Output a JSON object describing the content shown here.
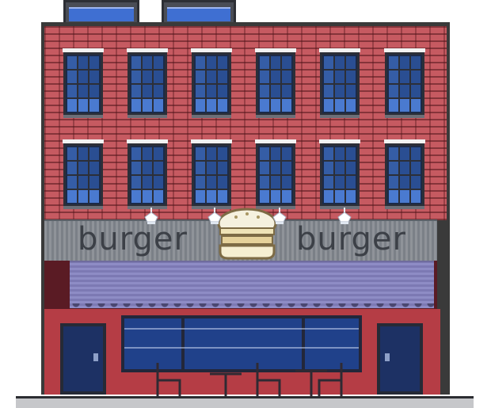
{
  "scene": {
    "description_label": "",
    "sign": {
      "left_word": "burger",
      "right_word": "burger",
      "logo": "burger-icon"
    },
    "colors": {
      "brick": "#c65a61",
      "awning": "#8e8cc5",
      "window_glass": "#2a4e92",
      "storefront": "#b53d45",
      "sign_panel": "#8f9399"
    },
    "floors": 2,
    "windows_per_floor": 6
  }
}
